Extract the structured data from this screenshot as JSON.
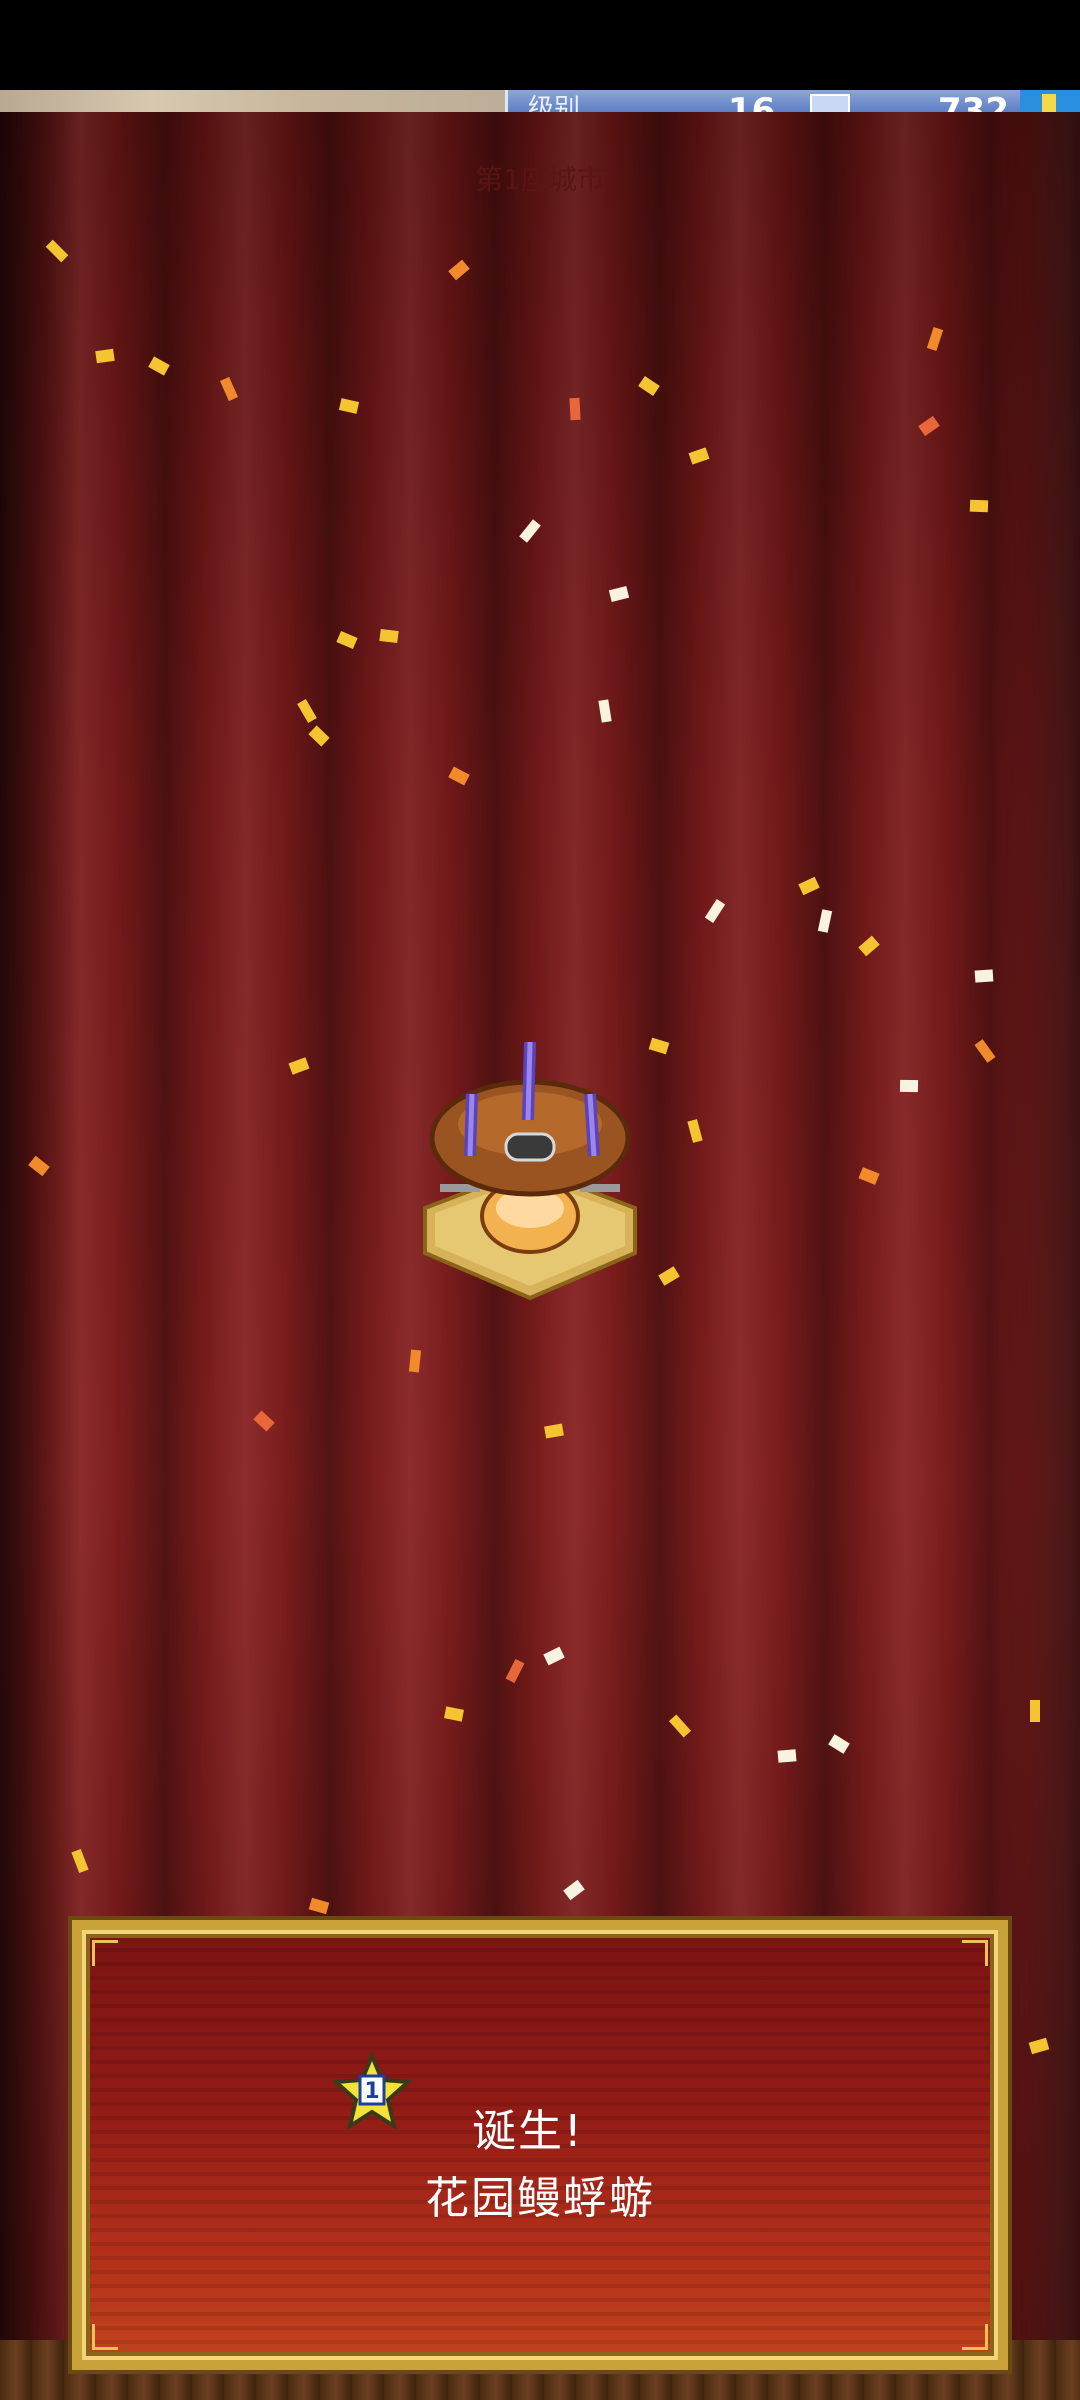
{
  "hud": {
    "level_label": "级别",
    "level_value": "16",
    "coin_value": "732"
  },
  "city_title": "第1座城市",
  "announcement": {
    "badge_number": "1",
    "birth_text": "诞生!",
    "monster_name": "花园鳗蜉蝣"
  },
  "colors": {
    "curtain": "#7a1a1b",
    "panel_border": "#c9a23a",
    "hud_panel": "#5f7fc4",
    "confetti": [
      "#f5c531",
      "#f08a2a",
      "#f7f3df",
      "#e8673a"
    ]
  },
  "icons": {
    "gem": "gem-icon",
    "star_badge": "star-badge-icon",
    "monster": "garden-eel-mayfly-sprite"
  }
}
